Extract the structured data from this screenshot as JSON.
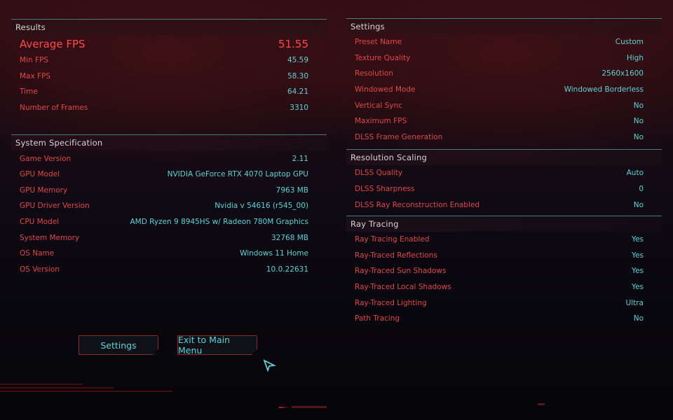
{
  "results": {
    "title": "Results",
    "average": {
      "label": "Average FPS",
      "value": "51.55"
    },
    "rows": [
      {
        "label": "Min FPS",
        "value": "45.59"
      },
      {
        "label": "Max FPS",
        "value": "58.30"
      },
      {
        "label": "Time",
        "value": "64.21"
      },
      {
        "label": "Number of Frames",
        "value": "3310"
      }
    ]
  },
  "system": {
    "title": "System Specification",
    "rows": [
      {
        "label": "Game Version",
        "value": "2.11"
      },
      {
        "label": "GPU Model",
        "value": "NVIDIA GeForce RTX 4070 Laptop GPU"
      },
      {
        "label": "GPU Memory",
        "value": "7963 MB"
      },
      {
        "label": "GPU Driver Version",
        "value": "Nvidia v 54616 (r545_00)"
      },
      {
        "label": "CPU Model",
        "value": "AMD Ryzen 9 8945HS w/ Radeon 780M Graphics"
      },
      {
        "label": "System Memory",
        "value": "32768 MB"
      },
      {
        "label": "OS Name",
        "value": "Windows 11 Home"
      },
      {
        "label": "OS Version",
        "value": "10.0.22631"
      }
    ]
  },
  "settings": {
    "title": "Settings",
    "rows": [
      {
        "label": "Preset Name",
        "value": "Custom"
      },
      {
        "label": "Texture Quality",
        "value": "High"
      },
      {
        "label": "Resolution",
        "value": "2560x1600"
      },
      {
        "label": "Windowed Mode",
        "value": "Windowed Borderless"
      },
      {
        "label": "Vertical Sync",
        "value": "No"
      },
      {
        "label": "Maximum FPS",
        "value": "No"
      },
      {
        "label": "DLSS Frame Generation",
        "value": "No"
      }
    ]
  },
  "resolution_scaling": {
    "title": "Resolution Scaling",
    "rows": [
      {
        "label": "DLSS Quality",
        "value": "Auto"
      },
      {
        "label": "DLSS Sharpness",
        "value": "0"
      },
      {
        "label": "DLSS Ray Reconstruction Enabled",
        "value": "No"
      }
    ]
  },
  "ray_tracing": {
    "title": "Ray Tracing",
    "rows": [
      {
        "label": "Ray Tracing Enabled",
        "value": "Yes"
      },
      {
        "label": "Ray-Traced Reflections",
        "value": "Yes"
      },
      {
        "label": "Ray-Traced Sun Shadows",
        "value": "Yes"
      },
      {
        "label": "Ray-Traced Local Shadows",
        "value": "Yes"
      },
      {
        "label": "Ray-Traced Lighting",
        "value": "Ultra"
      },
      {
        "label": "Path Tracing",
        "value": "No"
      }
    ]
  },
  "buttons": {
    "settings": "Settings",
    "exit": "Exit to Main Menu"
  },
  "icons": {
    "cursor": "pointer-cursor-icon"
  },
  "colors": {
    "label_red": "#e0484a",
    "value_cyan": "#5fd3d6",
    "divider_teal": "#4a8f90",
    "button_border": "#8c2b30"
  }
}
